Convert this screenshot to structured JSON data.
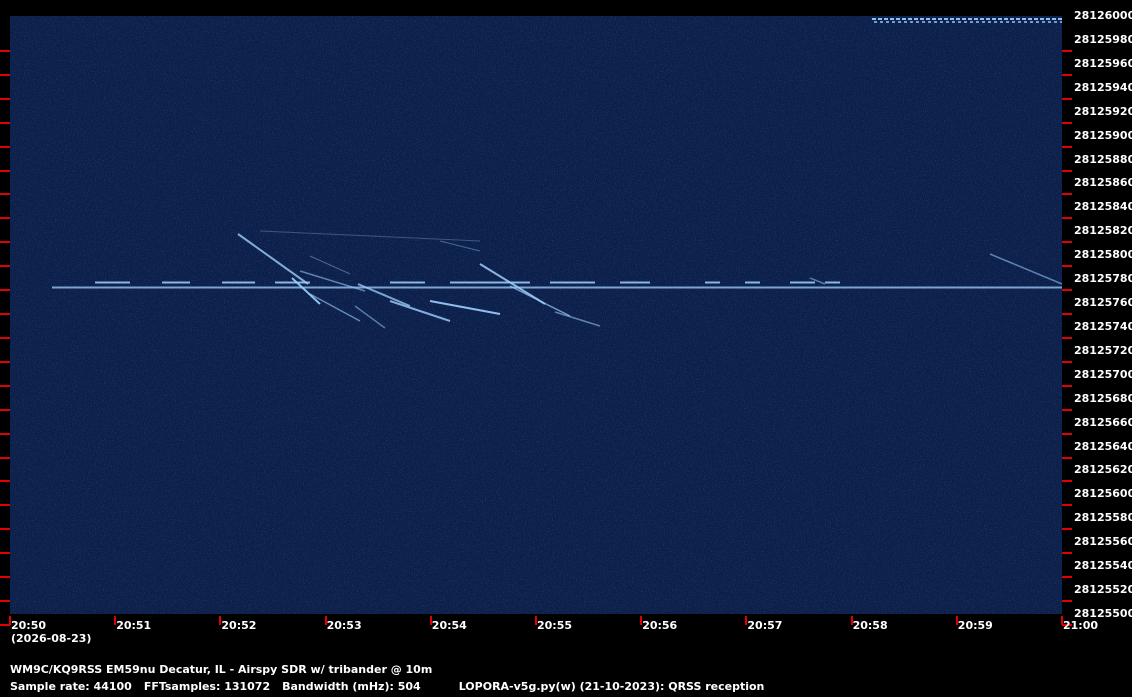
{
  "chart_data": {
    "type": "heatmap",
    "description_type": "spectrogram waterfall",
    "y_ticks": [
      "28126000",
      "28125980",
      "28125960",
      "28125940",
      "28125920",
      "28125900",
      "28125880",
      "28125860",
      "28125840",
      "28125820",
      "28125800",
      "28125780",
      "28125760",
      "28125740",
      "28125720",
      "28125700",
      "28125680",
      "28125660",
      "28125640",
      "28125620",
      "28125600",
      "28125580",
      "28125560",
      "28125540",
      "28125520",
      "28125500"
    ],
    "ylim": [
      28125500,
      28126000
    ],
    "x_ticks": [
      "20:50",
      "20:51",
      "20:52",
      "20:53",
      "20:54",
      "20:55",
      "20:56",
      "20:57",
      "20:58",
      "20:59",
      "21:00"
    ],
    "carrier_freq": 28125773,
    "colors": {
      "background": "#0b1f4a",
      "signal": "#9fd0ff",
      "tick": "#e00000"
    }
  },
  "date": "(2026-08-23)",
  "footer": {
    "line1": "WM9C/KQ9RSS EM59nu Decatur, IL - Airspy SDR w/ tribander @ 10m",
    "line2_parts": [
      "Sample rate: 44100",
      "FFTsamples: 131072",
      "Bandwidth (mHz): 504",
      "LOPORA-v5g.py(w) (21-10-2023): QRSS reception"
    ]
  }
}
